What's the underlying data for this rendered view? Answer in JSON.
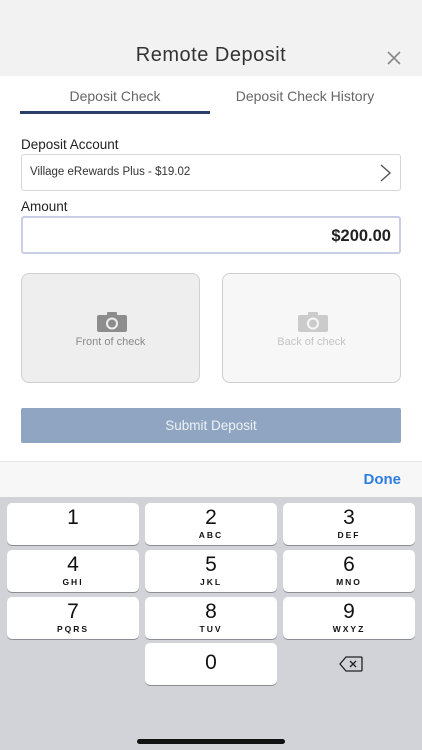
{
  "header": {
    "title": "Remote Deposit",
    "close_icon": "close-icon"
  },
  "tabs": [
    {
      "label": "Deposit Check",
      "active": true
    },
    {
      "label": "Deposit Check History",
      "active": false
    }
  ],
  "form": {
    "account_label": "Deposit Account",
    "account_value": "Village eRewards Plus - $19.02",
    "amount_label": "Amount",
    "amount_value": "$200.00",
    "front_check_label": "Front of check",
    "back_check_label": "Back of check",
    "camera_icon": "camera-icon",
    "submit_label": "Submit Deposit"
  },
  "keyboard": {
    "done_label": "Done",
    "keys": [
      {
        "digit": "1",
        "letters": ""
      },
      {
        "digit": "2",
        "letters": "ABC"
      },
      {
        "digit": "3",
        "letters": "DEF"
      },
      {
        "digit": "4",
        "letters": "GHI"
      },
      {
        "digit": "5",
        "letters": "JKL"
      },
      {
        "digit": "6",
        "letters": "MNO"
      },
      {
        "digit": "7",
        "letters": "PQRS"
      },
      {
        "digit": "8",
        "letters": "TUV"
      },
      {
        "digit": "9",
        "letters": "WXYZ"
      },
      {
        "digit": "0",
        "letters": ""
      }
    ],
    "delete_icon": "backspace-icon"
  },
  "colors": {
    "tab_underline": "#2a3f68",
    "submit_button": "#8fa5c1",
    "done_link": "#2f7de0",
    "keyboard_bg": "#d1d3d9"
  }
}
